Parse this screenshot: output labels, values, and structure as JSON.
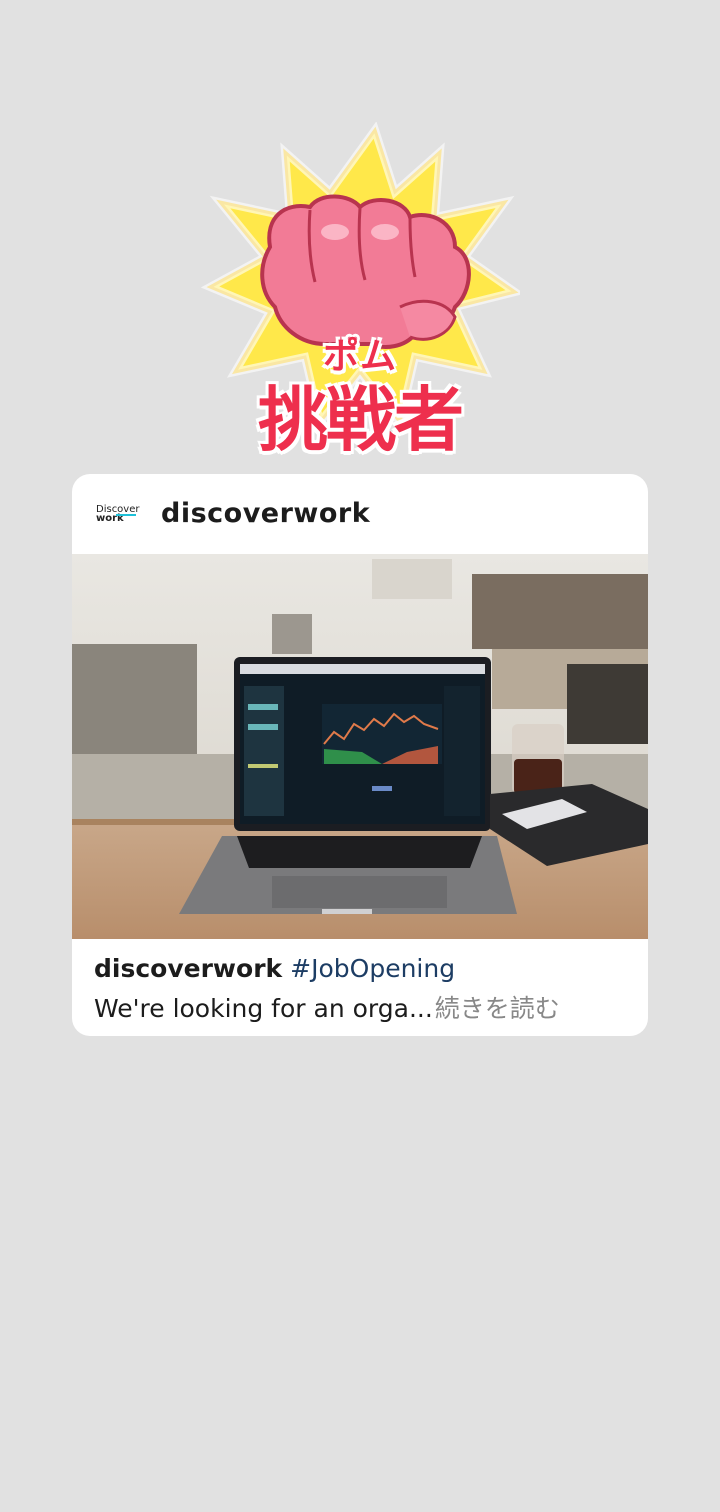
{
  "sticker": {
    "small_text": "ポム",
    "big_text": "挑戦者",
    "icon": "fist-icon"
  },
  "post": {
    "logo": {
      "line1": "Discover",
      "line2": "work"
    },
    "username": "discoverwork",
    "image": "laptop-trading-chart-photo",
    "caption": {
      "username": "discoverwork",
      "hashtag": "#JobOpening",
      "text": "We're looking for an orga...",
      "more_label": "続きを読む"
    }
  },
  "colors": {
    "background": "#e1e1e1",
    "card": "#ffffff",
    "sticker_red": "#ee2f4d",
    "sticker_yellow": "#ffe84a",
    "hashtag": "#1d3d64",
    "more": "#888888"
  }
}
